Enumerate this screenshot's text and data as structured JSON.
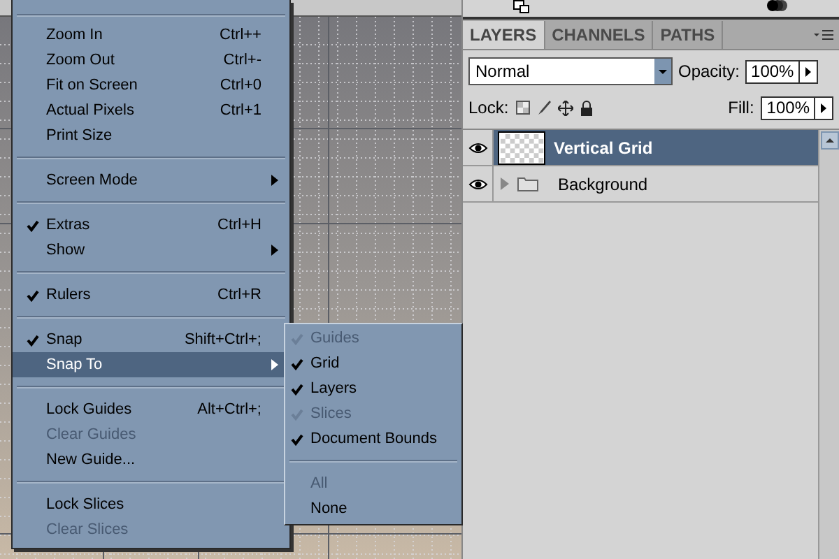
{
  "view_menu": {
    "items": [
      {
        "kind": "item",
        "label": "Zoom In",
        "shortcut": "Ctrl++",
        "checked": false,
        "disabled": false,
        "submenu": false,
        "selected": false
      },
      {
        "kind": "item",
        "label": "Zoom Out",
        "shortcut": "Ctrl+-",
        "checked": false,
        "disabled": false,
        "submenu": false,
        "selected": false
      },
      {
        "kind": "item",
        "label": "Fit on Screen",
        "shortcut": "Ctrl+0",
        "checked": false,
        "disabled": false,
        "submenu": false,
        "selected": false
      },
      {
        "kind": "item",
        "label": "Actual Pixels",
        "shortcut": "Ctrl+1",
        "checked": false,
        "disabled": false,
        "submenu": false,
        "selected": false
      },
      {
        "kind": "item",
        "label": "Print Size",
        "checked": false,
        "disabled": false,
        "submenu": false,
        "selected": false
      },
      {
        "kind": "separator"
      },
      {
        "kind": "item",
        "label": "Screen Mode",
        "checked": false,
        "disabled": false,
        "submenu": true,
        "selected": false
      },
      {
        "kind": "separator"
      },
      {
        "kind": "item",
        "label": "Extras",
        "shortcut": "Ctrl+H",
        "checked": true,
        "disabled": false,
        "submenu": false,
        "selected": false
      },
      {
        "kind": "item",
        "label": "Show",
        "checked": false,
        "disabled": false,
        "submenu": true,
        "selected": false
      },
      {
        "kind": "separator"
      },
      {
        "kind": "item",
        "label": "Rulers",
        "shortcut": "Ctrl+R",
        "checked": true,
        "disabled": false,
        "submenu": false,
        "selected": false
      },
      {
        "kind": "separator"
      },
      {
        "kind": "item",
        "label": "Snap",
        "shortcut": "Shift+Ctrl+;",
        "checked": true,
        "disabled": false,
        "submenu": false,
        "selected": false
      },
      {
        "kind": "item",
        "label": "Snap To",
        "checked": false,
        "disabled": false,
        "submenu": true,
        "selected": true
      },
      {
        "kind": "separator"
      },
      {
        "kind": "item",
        "label": "Lock Guides",
        "shortcut": "Alt+Ctrl+;",
        "checked": false,
        "disabled": false,
        "submenu": false,
        "selected": false
      },
      {
        "kind": "item",
        "label": "Clear Guides",
        "checked": false,
        "disabled": true,
        "submenu": false,
        "selected": false
      },
      {
        "kind": "item",
        "label": "New Guide...",
        "checked": false,
        "disabled": false,
        "submenu": false,
        "selected": false
      },
      {
        "kind": "separator"
      },
      {
        "kind": "item",
        "label": "Lock Slices",
        "checked": false,
        "disabled": false,
        "submenu": false,
        "selected": false
      },
      {
        "kind": "item",
        "label": "Clear Slices",
        "checked": false,
        "disabled": true,
        "submenu": false,
        "selected": false
      }
    ]
  },
  "snap_to_submenu": {
    "items": [
      {
        "kind": "item",
        "label": "Guides",
        "checked": true,
        "disabled": true
      },
      {
        "kind": "item",
        "label": "Grid",
        "checked": true,
        "disabled": false
      },
      {
        "kind": "item",
        "label": "Layers",
        "checked": true,
        "disabled": false
      },
      {
        "kind": "item",
        "label": "Slices",
        "checked": true,
        "disabled": true
      },
      {
        "kind": "item",
        "label": "Document Bounds",
        "checked": true,
        "disabled": false
      },
      {
        "kind": "separator"
      },
      {
        "kind": "item",
        "label": "All",
        "checked": false,
        "disabled": true
      },
      {
        "kind": "item",
        "label": "None",
        "checked": false,
        "disabled": false
      }
    ]
  },
  "layers_panel": {
    "tabs": [
      {
        "label": "LAYERS",
        "selected": true
      },
      {
        "label": "CHANNELS",
        "selected": false
      },
      {
        "label": "PATHS",
        "selected": false
      }
    ],
    "blend_mode": {
      "value": "Normal"
    },
    "opacity": {
      "label": "Opacity:",
      "value": "100%"
    },
    "lock": {
      "label": "Lock:"
    },
    "fill": {
      "label": "Fill:",
      "value": "100%"
    },
    "layers": [
      {
        "kind": "layer",
        "name": "Vertical Grid",
        "visible": true,
        "selected": true
      },
      {
        "kind": "group",
        "name": "Background",
        "visible": true,
        "selected": false,
        "expanded": false
      }
    ]
  }
}
